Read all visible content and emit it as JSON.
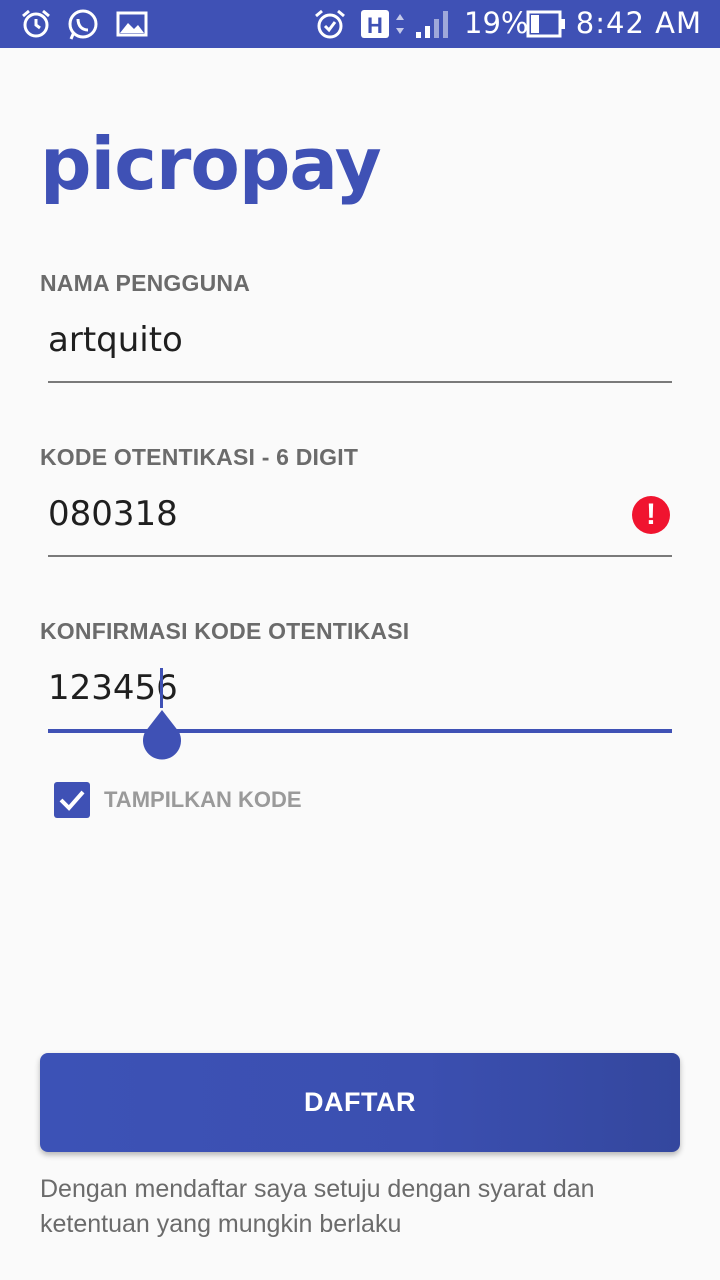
{
  "status_bar": {
    "icons_left": [
      "alarm-icon",
      "whatsapp-icon",
      "image-icon"
    ],
    "icons_right": [
      "alarm-icon",
      "network-h-icon",
      "signal-icon",
      "battery-icon"
    ],
    "battery_percent": "19%",
    "time": "8:42 AM"
  },
  "app": {
    "logo": "picropay"
  },
  "form": {
    "username": {
      "label": "NAMA PENGGUNA",
      "value": "artquito"
    },
    "auth_code": {
      "label": "KODE OTENTIKASI - 6 DIGIT",
      "value": "080318",
      "error_icon": "!"
    },
    "confirm_code": {
      "label": "KONFIRMASI KODE OTENTIKASI",
      "value": "123456"
    },
    "show_code": {
      "label": "TAMPILKAN KODE",
      "checked": true
    }
  },
  "register_button": {
    "label": "DAFTAR"
  },
  "terms": {
    "line1": "Dengan mendaftar saya setuju dengan syarat dan",
    "line2": "ketentuan yang mungkin berlaku"
  },
  "colors": {
    "primary": "#3f51b5",
    "error": "#f0142f",
    "background": "#fafafa"
  }
}
